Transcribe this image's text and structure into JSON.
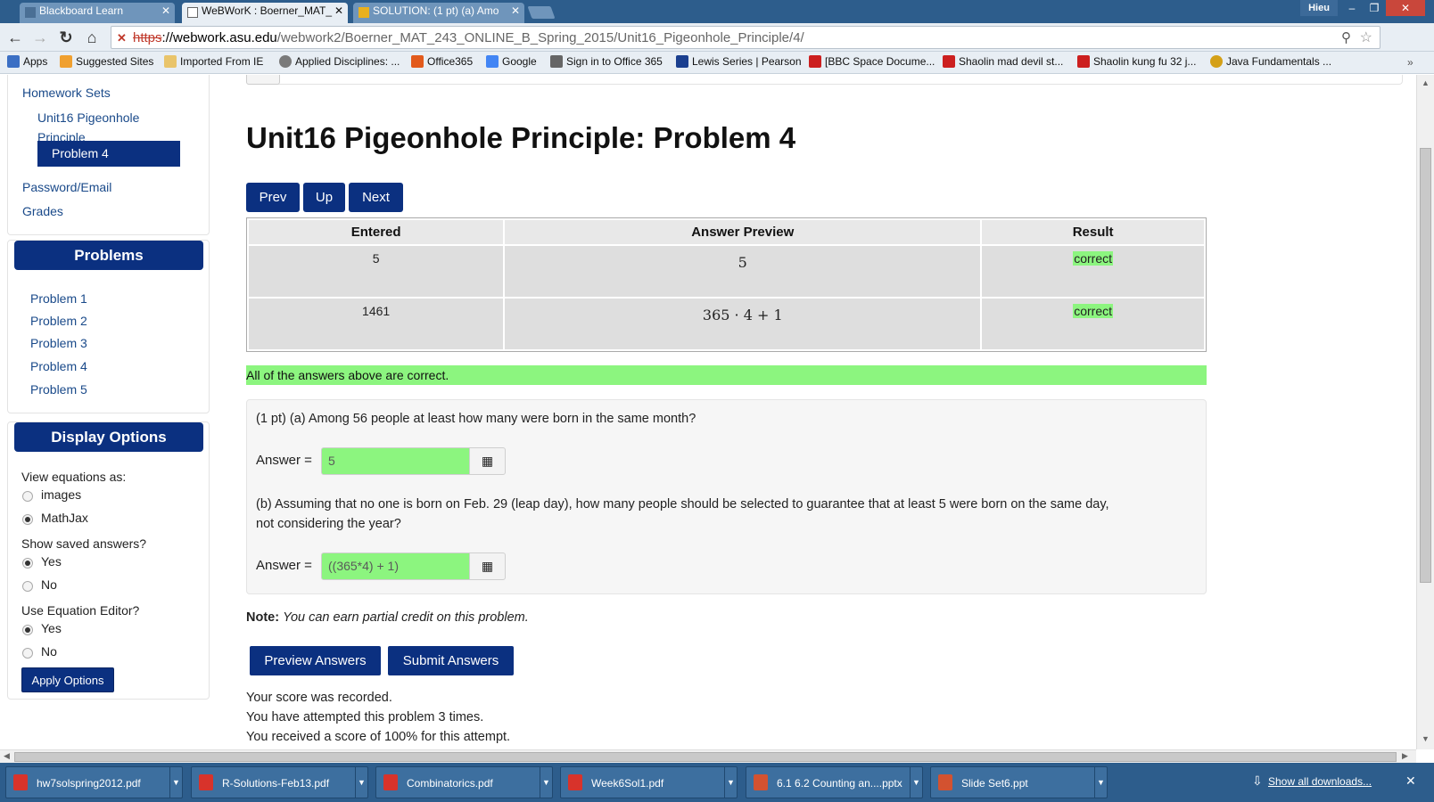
{
  "browser": {
    "tabs": [
      {
        "title": "Blackboard Learn",
        "active": false
      },
      {
        "title": "WeBWorK : Boerner_MAT_",
        "active": true
      },
      {
        "title": "SOLUTION: (1 pt) (a) Amo",
        "active": false
      }
    ],
    "user": "Hieu",
    "window_controls": {
      "minimize": "–",
      "restore": "❐",
      "close": "✕"
    },
    "url": {
      "protocol": "https",
      "domain": "://webwork.asu.edu",
      "path": "/webwork2/Boerner_MAT_243_ONLINE_B_Spring_2015/Unit16_Pigeonhole_Principle/4/"
    },
    "bookmarks": [
      {
        "label": "Apps",
        "icon": "apps-grid-icon",
        "color": "#3b6fc4"
      },
      {
        "label": "Suggested Sites",
        "icon": "suggested-sites-icon",
        "color": "#f0a030"
      },
      {
        "label": "Imported From IE",
        "icon": "folder-icon",
        "color": "#e9c46a"
      },
      {
        "label": "Applied Disciplines: ...",
        "icon": "applied-disciplines-icon",
        "color": "#7a7a7a"
      },
      {
        "label": "Office365",
        "icon": "office365-icon",
        "color": "#e25a1c"
      },
      {
        "label": "Google",
        "icon": "google-icon",
        "color": "#4285f4"
      },
      {
        "label": "Sign in to Office 365",
        "icon": "office365-signin-icon",
        "color": "#666666"
      },
      {
        "label": "Lewis Series | Pearson",
        "icon": "pearson-icon",
        "color": "#1b3f8f"
      },
      {
        "label": "[BBC Space Docume...",
        "icon": "youtube-icon",
        "color": "#cc1f1f"
      },
      {
        "label": "Shaolin mad devil st...",
        "icon": "youtube-icon",
        "color": "#cc1f1f"
      },
      {
        "label": "Shaolin kung fu 32 j...",
        "icon": "youtube-icon",
        "color": "#cc1f1f"
      },
      {
        "label": "Java Fundamentals ...",
        "icon": "java-icon",
        "color": "#d4a017"
      }
    ],
    "bookmarks_more": "»"
  },
  "sidebar": {
    "nav": {
      "homework_sets": "Homework Sets",
      "set_name_line1": "Unit16 Pigeonhole",
      "set_name_line2": "Principle",
      "active_problem": "Problem 4",
      "password_email": "Password/Email",
      "grades": "Grades"
    },
    "problems": {
      "header": "Problems",
      "items": [
        "Problem 1",
        "Problem 2",
        "Problem 3",
        "Problem 4",
        "Problem 5"
      ]
    },
    "display_options": {
      "header": "Display Options",
      "view_equations_label": "View equations as:",
      "view_equations_options": [
        {
          "label": "images",
          "checked": false
        },
        {
          "label": "MathJax",
          "checked": true
        }
      ],
      "show_saved_label": "Show saved answers?",
      "show_saved_options": [
        {
          "label": "Yes",
          "checked": true
        },
        {
          "label": "No",
          "checked": false
        }
      ],
      "equation_editor_label": "Use Equation Editor?",
      "equation_editor_options": [
        {
          "label": "Yes",
          "checked": true
        },
        {
          "label": "No",
          "checked": false
        }
      ],
      "apply_button": "Apply Options"
    }
  },
  "main": {
    "title": "Unit16 Pigeonhole Principle: Problem 4",
    "nav_buttons": {
      "prev": "Prev",
      "up": "Up",
      "next": "Next"
    },
    "results_table": {
      "headers": [
        "Entered",
        "Answer Preview",
        "Result"
      ],
      "rows": [
        {
          "entered": "5",
          "preview": "5",
          "result": "correct"
        },
        {
          "entered": "1461",
          "preview": "365 · 4 + 1",
          "result": "correct"
        }
      ]
    },
    "all_correct_message": "All of the answers above are correct.",
    "problem": {
      "part_a": "(1 pt) (a) Among 56 people at least how many were born in the same month?",
      "answer_label": "Answer =",
      "answer_a": "5",
      "part_b_line1": "(b) Assuming that no one is born on Feb. 29 (leap day), how many people should be selected to guarantee that at least 5 were born on the same day,",
      "part_b_line2": "not considering the year?",
      "answer_b": "((365*4) + 1)",
      "equation_button_icon": "grid-icon"
    },
    "note_label": "Note:",
    "note_text": "You can earn partial credit on this problem.",
    "buttons": {
      "preview": "Preview Answers",
      "submit": "Submit Answers"
    },
    "score_lines": [
      "Your score was recorded.",
      "You have attempted this problem 3 times.",
      "You received a score of 100% for this attempt."
    ]
  },
  "downloads": {
    "items": [
      "hw7solspring2012.pdf",
      "R-Solutions-Feb13.pdf",
      "Combinatorics.pdf",
      "Week6Sol1.pdf",
      "6.1 6.2 Counting an....pptx",
      "Slide Set6.ppt"
    ],
    "show_all": "Show all downloads...",
    "close": "✕"
  },
  "colors": {
    "primary_blue": "#0b3080",
    "correct_green": "#8cf57f",
    "chrome_blue": "#2d5d8c",
    "link_blue": "#1a4a8a"
  }
}
